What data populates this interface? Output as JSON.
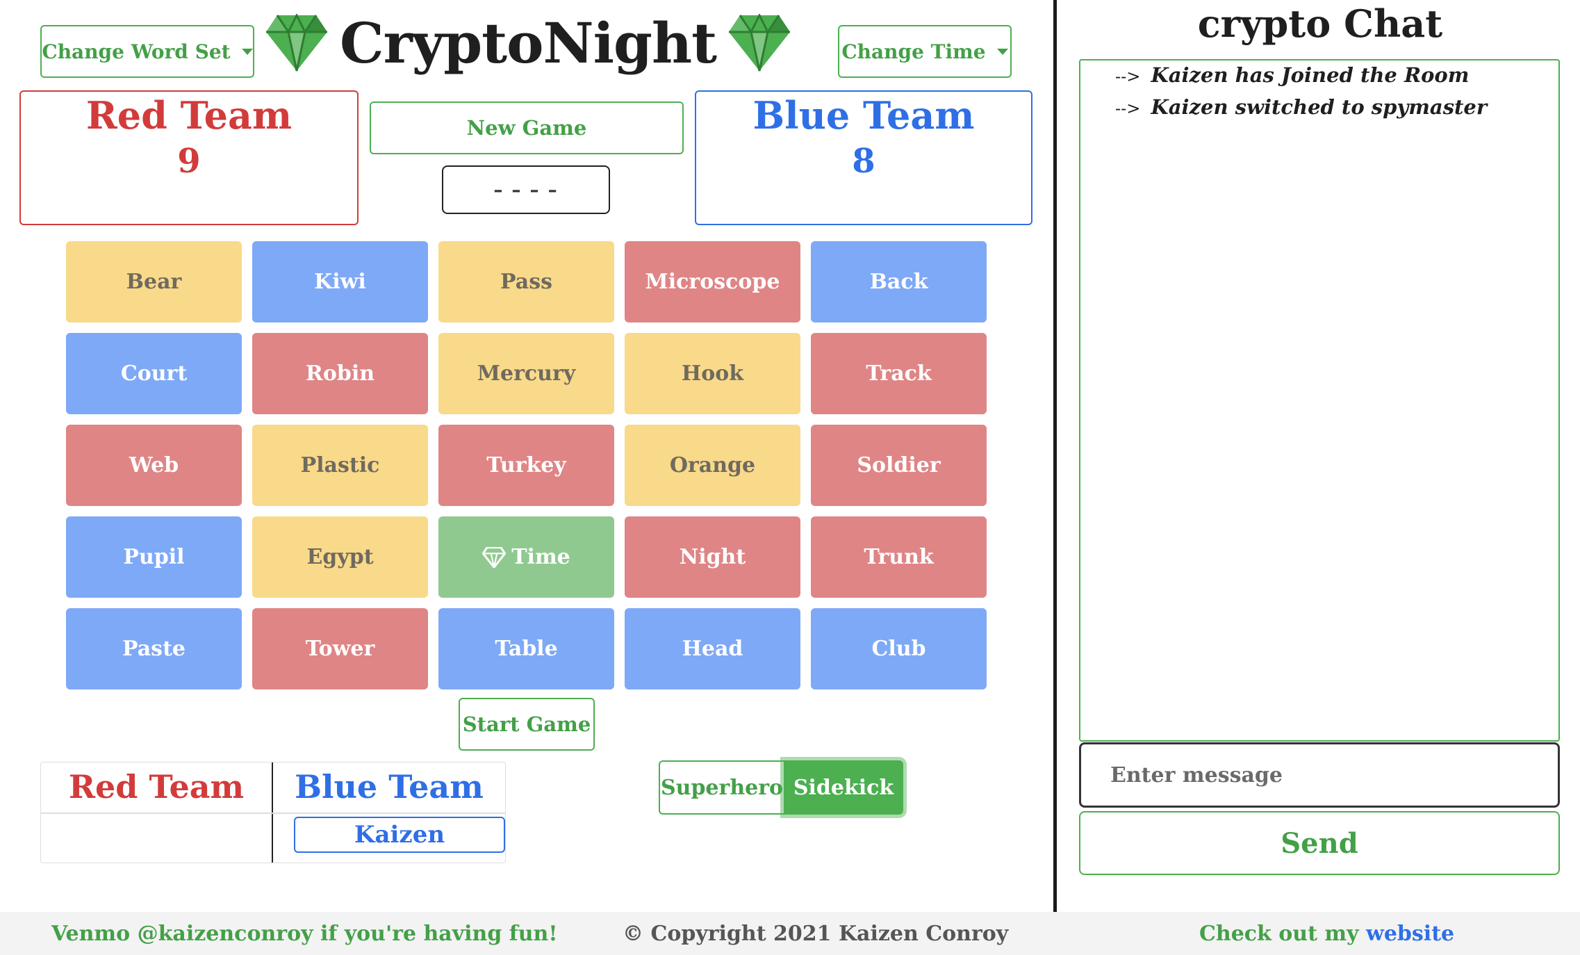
{
  "header": {
    "title": "CryptoNight",
    "change_word_set": "Change Word Set",
    "change_time": "Change Time",
    "new_game": "New Game",
    "timer_display": "----"
  },
  "teams": {
    "red": {
      "name": "Red Team",
      "remaining": "9",
      "color": "#d23b3b"
    },
    "blue": {
      "name": "Blue Team",
      "remaining": "8",
      "color": "#2f6fe6"
    }
  },
  "board": {
    "cards": [
      {
        "word": "Bear",
        "color": "yellow"
      },
      {
        "word": "Kiwi",
        "color": "blue"
      },
      {
        "word": "Pass",
        "color": "yellow"
      },
      {
        "word": "Microscope",
        "color": "red"
      },
      {
        "word": "Back",
        "color": "blue"
      },
      {
        "word": "Court",
        "color": "blue"
      },
      {
        "word": "Robin",
        "color": "red"
      },
      {
        "word": "Mercury",
        "color": "yellow"
      },
      {
        "word": "Hook",
        "color": "yellow"
      },
      {
        "word": "Track",
        "color": "red"
      },
      {
        "word": "Web",
        "color": "red"
      },
      {
        "word": "Plastic",
        "color": "yellow"
      },
      {
        "word": "Turkey",
        "color": "red"
      },
      {
        "word": "Orange",
        "color": "yellow"
      },
      {
        "word": "Soldier",
        "color": "red"
      },
      {
        "word": "Pupil",
        "color": "blue"
      },
      {
        "word": "Egypt",
        "color": "yellow"
      },
      {
        "word": "Time",
        "color": "green",
        "icon": "gem-icon"
      },
      {
        "word": "Night",
        "color": "red"
      },
      {
        "word": "Trunk",
        "color": "red"
      },
      {
        "word": "Paste",
        "color": "blue"
      },
      {
        "word": "Tower",
        "color": "red"
      },
      {
        "word": "Table",
        "color": "blue"
      },
      {
        "word": "Head",
        "color": "blue"
      },
      {
        "word": "Club",
        "color": "blue"
      }
    ],
    "start_game": "Start Game"
  },
  "roster": {
    "red_header": "Red Team",
    "blue_header": "Blue Team",
    "blue_players": [
      "Kaizen"
    ]
  },
  "role_toggle": {
    "option_1": "Superhero",
    "option_2": "Sidekick",
    "selected": "Sidekick"
  },
  "chat": {
    "title": "crypto Chat",
    "messages": [
      {
        "arrow": "-->",
        "text": "Kaizen has Joined the Room"
      },
      {
        "arrow": "-->",
        "text": "Kaizen switched to spymaster"
      }
    ],
    "input_placeholder": "Enter message",
    "send_label": "Send"
  },
  "footer": {
    "left": "Venmo @kaizenconroy if you're having fun!",
    "middle": "© Copyright 2021 Kaizen Conroy",
    "right_prefix": "Check out my ",
    "right_link": "website"
  },
  "colors": {
    "accent_green": "#4caf50",
    "card_yellow": "#f9d98a",
    "card_blue": "#7ea9f7",
    "card_red": "#df8586",
    "card_green": "#90c990"
  }
}
